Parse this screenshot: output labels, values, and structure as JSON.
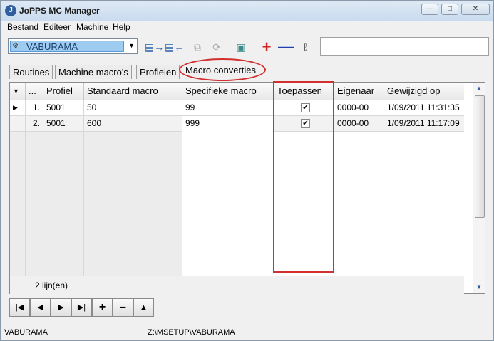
{
  "window": {
    "title": "JoPPS MC Manager",
    "icon": "app-icon"
  },
  "menu": [
    "Bestand",
    "Editeer",
    "Machine",
    "Help"
  ],
  "toolbar": {
    "machine_select": "VABURAMA",
    "search_value": ""
  },
  "tabs": [
    "Routines",
    "Machine macro's",
    "Profielen",
    "Macro converties"
  ],
  "active_tab": "Macro converties",
  "grid": {
    "headers": [
      "...",
      "Profiel",
      "Standaard macro",
      "Specifieke macro",
      "Toepassen",
      "Eigenaar",
      "Gewijzigd op"
    ],
    "rows": [
      {
        "nr": "1.",
        "profiel": "5001",
        "standaard": "50",
        "specifiek": "99",
        "toepassen": true,
        "eigenaar": "0000-00",
        "gewijzigd": "1/09/2011 11:31:35"
      },
      {
        "nr": "2.",
        "profiel": "5001",
        "standaard": "600",
        "specifiek": "999",
        "toepassen": true,
        "eigenaar": "0000-00",
        "gewijzigd": "1/09/2011 11:17:09"
      }
    ],
    "footer": "2 lijn(en)"
  },
  "status": {
    "left": "VABURAMA",
    "path": "Z:\\MSETUP\\VABURAMA"
  },
  "colors": {
    "highlight": "#d23030",
    "selection": "#9ecbf0"
  }
}
